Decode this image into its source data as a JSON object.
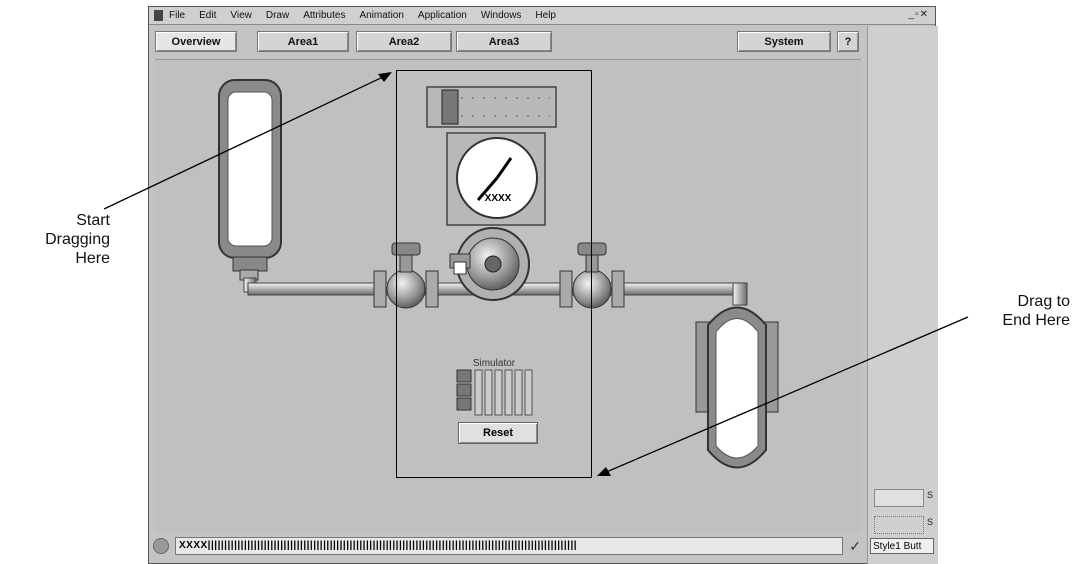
{
  "menu": [
    "File",
    "Edit",
    "View",
    "Draw",
    "Attributes",
    "Animation",
    "Application",
    "Windows",
    "Help"
  ],
  "tabs": {
    "overview": "Overview",
    "area1": "Area1",
    "area2": "Area2",
    "area3": "Area3",
    "system": "System",
    "help": "?"
  },
  "gauge": {
    "readout": "XXXX"
  },
  "simulator": {
    "title": "Simulator",
    "reset_label": "Reset"
  },
  "statusbar": {
    "value": "XXXX||||||||||||||||||||||||||||||||||||||||||||||||||||||||||||||||||||||||||||||||||||||||||||||||||||||||||||||||"
  },
  "right_panel": {
    "style_label": "Style1 Butt",
    "s1": "S",
    "s2": "S"
  },
  "annotations": {
    "start_l1": "Start",
    "start_l2": "Dragging",
    "start_l3": "Here",
    "end_l1": "Drag to",
    "end_l2": "End Here"
  },
  "colors": {
    "window_bg": "#c4c4c4",
    "canvas_bg": "#c0c0c0",
    "annotation_line": "#000000"
  }
}
